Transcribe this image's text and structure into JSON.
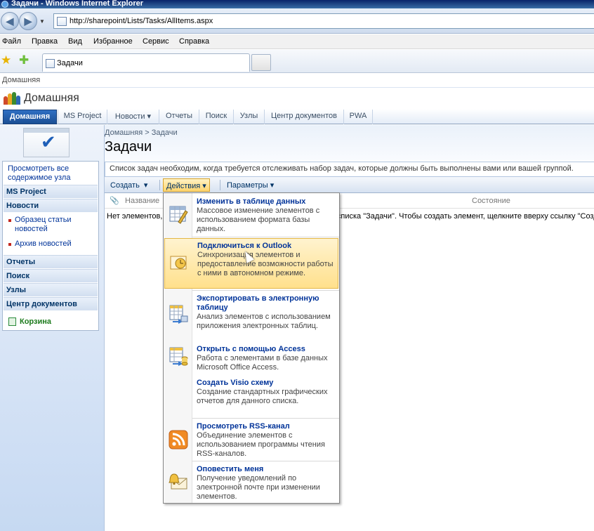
{
  "window": {
    "title": "Задачи - Windows Internet Explorer"
  },
  "address": {
    "url": "http://sharepoint/Lists/Tasks/AllItems.aspx"
  },
  "menu": [
    "Файл",
    "Правка",
    "Вид",
    "Избранное",
    "Сервис",
    "Справка"
  ],
  "browser_tab": {
    "label": "Задачи"
  },
  "site": {
    "top_breadcrumb": "Домашняя",
    "title": "Домашняя",
    "topnav": [
      "Домашняя",
      "MS Project",
      "Новости ▾",
      "Отчеты",
      "Поиск",
      "Узлы",
      "Центр документов",
      "PWA"
    ]
  },
  "page": {
    "breadcrumb": "Домашняя > Задачи",
    "title": "Задачи",
    "description": "Список задач необходим, когда требуется отслеживать набор задач, которые должны быть выполнены вами или вашей группой.",
    "empty_message": "Нет элементов, которые можно показать в этом представлении списка \"Задачи\". Чтобы создать элемент, щелкните вверху ссылку \"Создать\".",
    "columns": {
      "name": "Название",
      "state": "Состояние"
    }
  },
  "toolbar": {
    "create": "Создать",
    "actions": "Действия",
    "params": "Параметры"
  },
  "leftnav": {
    "view_all": "Просмотреть все содержимое узла",
    "ms_project": "MS Project",
    "news": "Новости",
    "news_items": [
      "Образец статьи новостей",
      "Архив новостей"
    ],
    "reports": "Отчеты",
    "search": "Поиск",
    "sites": "Узлы",
    "doc_center": "Центр документов",
    "recycle": "Корзина"
  },
  "actions_menu": [
    {
      "title": "Изменить в таблице данных",
      "desc": "Массовое изменение элементов с использованием формата базы данных.",
      "icon": "datasheet-icon"
    },
    {
      "title": "Подключиться к Outlook",
      "desc": "Синхронизация элементов и предоставление возможности работы с ними в автономном режиме.",
      "icon": "outlook-icon"
    },
    {
      "title": "Экспортировать в электронную таблицу",
      "desc": "Анализ элементов с использованием приложения электронных таблиц.",
      "icon": "spreadsheet-icon"
    },
    {
      "title": "Открыть с помощью Access",
      "desc": "Работа с элементами в базе данных Microsoft Office Access.",
      "icon": "access-icon"
    },
    {
      "title": "Создать Visio схему",
      "desc": "Создание стандартных графических отчетов для данного списка.",
      "icon": "visio-icon"
    },
    {
      "title": "Просмотреть RSS-канал",
      "desc": "Объединение элементов с использованием программы чтения RSS-каналов.",
      "icon": "rss-icon"
    },
    {
      "title": "Оповестить меня",
      "desc": "Получение уведомлений по электронной почте при изменении элементов.",
      "icon": "alert-icon"
    }
  ]
}
